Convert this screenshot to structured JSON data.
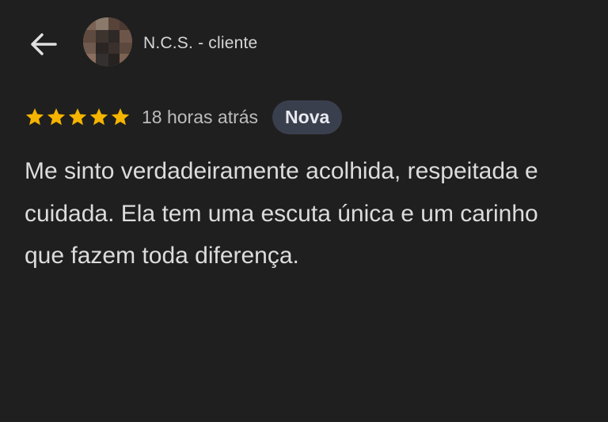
{
  "header": {
    "back_icon": "arrow-left-icon",
    "reviewer_name": "N.C.S. - cliente"
  },
  "review": {
    "rating": 5,
    "rating_max": 5,
    "star_color": "#f5b400",
    "time": "18 horas atrás",
    "badge": "Nova",
    "text": "Me sinto verdadeiramente acolhida, respeitada e cuidada. Ela tem uma escuta única e um carinho que fazem toda diferença."
  },
  "colors": {
    "background": "#1f1f1f",
    "text": "#dcdcdc",
    "badge_bg": "#3a3f4e"
  }
}
